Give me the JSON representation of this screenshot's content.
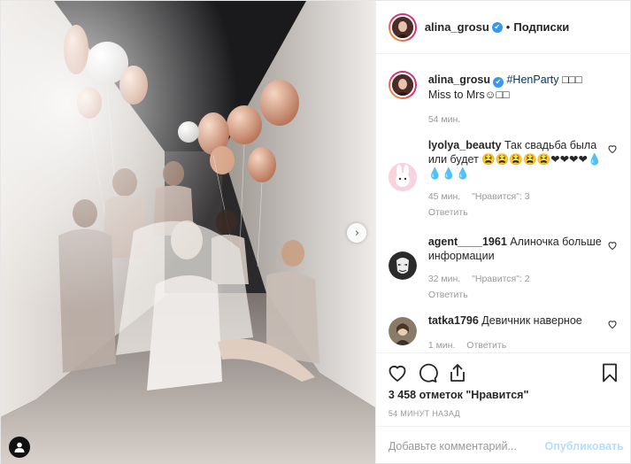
{
  "post": {
    "author": "alina_grosu",
    "follow_separator": "•",
    "follow_label": "Подписки",
    "verified_mark": "✔"
  },
  "caption": {
    "username": "alina_grosu",
    "hashtag": "#HenParty",
    "text_after_hashtag": " □□□",
    "line2": "Miss to Mrs☺□□",
    "time": "54 мин."
  },
  "comments": [
    {
      "username": "lyolya_beauty",
      "text": "Так свадьба была или будет 😫😫😫😫😫❤❤❤❤💧💧💧💧",
      "time": "45 мин.",
      "likes": "\"Нравится\": 3",
      "reply": "Ответить",
      "avatar_color": "#f6c9d6",
      "avatar_icon": "bunny-avatar"
    },
    {
      "username": "agent____1961",
      "text": "Алиночка больше информации",
      "time": "32 мин.",
      "likes": "\"Нравится\": 2",
      "reply": "Ответить",
      "avatar_color": "#2b2b2b",
      "avatar_icon": "mask-avatar"
    },
    {
      "username": "tatka1796",
      "text": "Девичник наверное",
      "time": "1 мин.",
      "likes": "",
      "reply": "Ответить",
      "avatar_color": "#7a6a58",
      "avatar_icon": "portrait-avatar"
    }
  ],
  "actions": {
    "likes_count": "3 458 отметок \"Нравится\"",
    "time_ago": "54 МИНУТ НАЗАД"
  },
  "composer": {
    "placeholder": "Добавьте комментарий...",
    "publish_label": "Опубликовать"
  },
  "colors": {
    "link_blue": "#003569",
    "verified_blue": "#3897f0",
    "publish_disabled": "#b2dffc",
    "meta_gray": "#999999"
  },
  "photo": {
    "next_arrow_glyph": "›",
    "description_icon": "user-tag-icon"
  }
}
